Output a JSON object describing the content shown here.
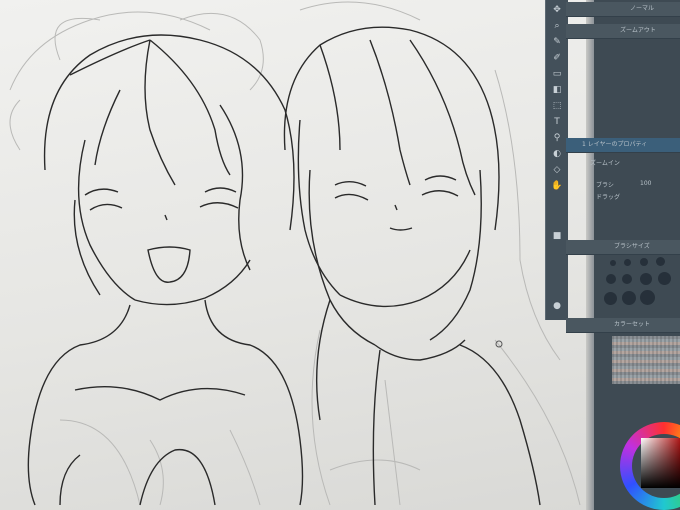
{
  "app": {
    "accent_color": "#3b5f7a",
    "panel_color": "#3e4a53",
    "canvas_color": "#eeeeec"
  },
  "panel": {
    "tab_top": "ノーマル",
    "tab_sub": "ズームアウト",
    "layer_header": "1 レイヤーのプロパティ",
    "layer_zoom": "ズームイン",
    "opacity_label": "ブラシ",
    "opacity_value": "100",
    "drag_label": "ドラッグ",
    "brush_size_title": "ブラシサイズ",
    "color_set_title": "カラーセット"
  },
  "toolbar": {
    "tools": [
      "move-icon",
      "zoom-icon",
      "pen-icon",
      "brush-icon",
      "eraser-icon",
      "fill-icon",
      "select-icon",
      "text-icon",
      "eyedropper-icon",
      "gradient-icon",
      "figure-icon",
      "hand-icon"
    ]
  }
}
